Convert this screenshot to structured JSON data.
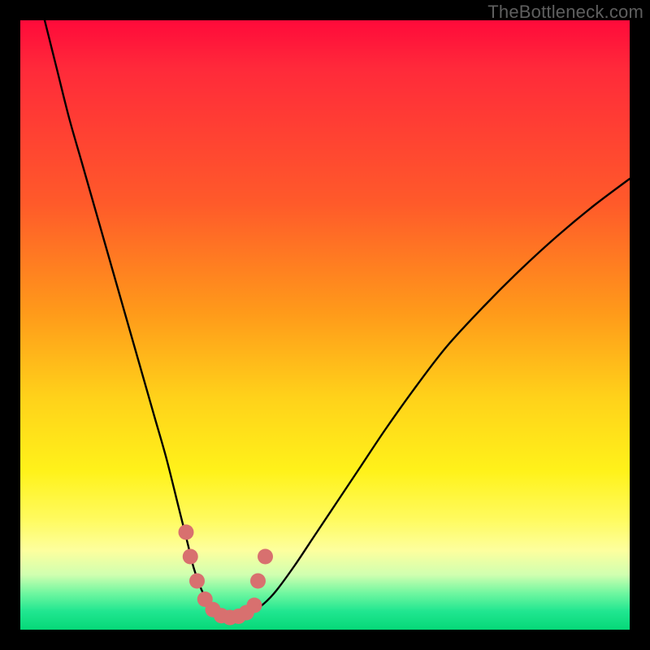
{
  "watermark": "TheBottleneck.com",
  "chart_data": {
    "type": "line",
    "title": "",
    "xlabel": "",
    "ylabel": "",
    "xlim": [
      0,
      100
    ],
    "ylim": [
      0,
      100
    ],
    "series": [
      {
        "name": "bottleneck-curve",
        "x": [
          4,
          6,
          8,
          10,
          12,
          14,
          16,
          18,
          20,
          22,
          24,
          26,
          27.5,
          28.5,
          30,
          32,
          33.5,
          34.7,
          36,
          38,
          40,
          42,
          45,
          48,
          52,
          56,
          60,
          65,
          70,
          76,
          82,
          88,
          94,
          100
        ],
        "y": [
          100,
          92,
          84,
          77,
          70,
          63,
          56,
          49,
          42,
          35,
          28,
          20,
          14,
          10,
          6,
          3.2,
          2.2,
          2.0,
          2.1,
          2.9,
          4.3,
          6.4,
          10.5,
          15,
          21,
          27,
          33,
          40,
          46.5,
          53,
          59,
          64.5,
          69.5,
          74
        ]
      }
    ],
    "markers": {
      "name": "highlight-dots",
      "color": "#d8706f",
      "points_x": [
        27.2,
        27.9,
        29.0,
        30.3,
        31.6,
        33.0,
        34.4,
        35.8,
        37.1,
        38.4,
        39.0,
        40.2
      ],
      "points_y": [
        16.0,
        12.0,
        8.0,
        5.0,
        3.3,
        2.3,
        2.0,
        2.2,
        2.8,
        4.0,
        8.0,
        12.0
      ]
    },
    "background": {
      "type": "vertical-gradient",
      "stops": [
        {
          "pos": 0,
          "color": "#ff0a3a"
        },
        {
          "pos": 8,
          "color": "#ff2a3a"
        },
        {
          "pos": 30,
          "color": "#ff5a2a"
        },
        {
          "pos": 48,
          "color": "#ff9a1a"
        },
        {
          "pos": 62,
          "color": "#ffd21a"
        },
        {
          "pos": 74,
          "color": "#fff21a"
        },
        {
          "pos": 82,
          "color": "#fffb60"
        },
        {
          "pos": 87,
          "color": "#fdff9e"
        },
        {
          "pos": 91,
          "color": "#d0ffb0"
        },
        {
          "pos": 94,
          "color": "#70f7a0"
        },
        {
          "pos": 97,
          "color": "#20e690"
        },
        {
          "pos": 100,
          "color": "#06d878"
        }
      ]
    }
  }
}
